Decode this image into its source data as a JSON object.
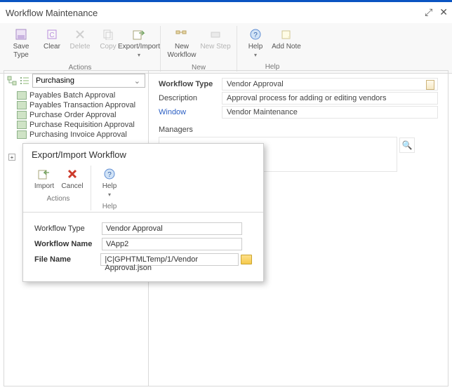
{
  "window": {
    "title": "Workflow Maintenance"
  },
  "ribbon": {
    "groups": [
      {
        "label": "Actions",
        "buttons": [
          {
            "name": "save-type-button",
            "label": "Save Type",
            "disabled": false
          },
          {
            "name": "clear-button",
            "label": "Clear",
            "disabled": false
          },
          {
            "name": "delete-button",
            "label": "Delete",
            "disabled": true
          },
          {
            "name": "copy-button",
            "label": "Copy",
            "disabled": true
          },
          {
            "name": "export-import-button",
            "label": "Export/Import",
            "caret": true,
            "disabled": false
          }
        ]
      },
      {
        "label": "New",
        "buttons": [
          {
            "name": "new-workflow-button",
            "label": "New Workflow",
            "disabled": false
          },
          {
            "name": "new-step-button",
            "label": "New Step",
            "disabled": true
          }
        ]
      },
      {
        "label": "Help",
        "buttons": [
          {
            "name": "help-button",
            "label": "Help",
            "caret": true,
            "disabled": false
          },
          {
            "name": "add-note-button",
            "label": "Add Note",
            "disabled": false
          }
        ]
      }
    ]
  },
  "nav": {
    "dropdown": "Purchasing",
    "items": [
      "Payables Batch Approval",
      "Payables Transaction Approval",
      "Purchase Order Approval",
      "Purchase Requisition Approval",
      "Purchasing Invoice Approval"
    ]
  },
  "detail": {
    "workflowTypeLabel": "Workflow Type",
    "workflowType": "Vendor Approval",
    "descriptionLabel": "Description",
    "description": "Approval process for adding or editing vendors",
    "windowLabel": "Window",
    "window": "Vendor Maintenance",
    "managersLabel": "Managers"
  },
  "modal": {
    "title": "Export/Import Workflow",
    "ribbon": {
      "groups": [
        {
          "label": "Actions",
          "buttons": [
            {
              "name": "import-button",
              "label": "Import"
            },
            {
              "name": "cancel-button",
              "label": "Cancel"
            }
          ]
        },
        {
          "label": "Help",
          "buttons": [
            {
              "name": "modal-help-button",
              "label": "Help",
              "caret": true
            }
          ]
        }
      ]
    },
    "fields": {
      "workflowTypeLabel": "Workflow Type",
      "workflowType": "Vendor Approval",
      "workflowNameLabel": "Workflow Name",
      "workflowName": "VApp2",
      "fileNameLabel": "File Name",
      "fileName": "|C|GPHTMLTemp/1/Vendor Approval.json"
    }
  }
}
